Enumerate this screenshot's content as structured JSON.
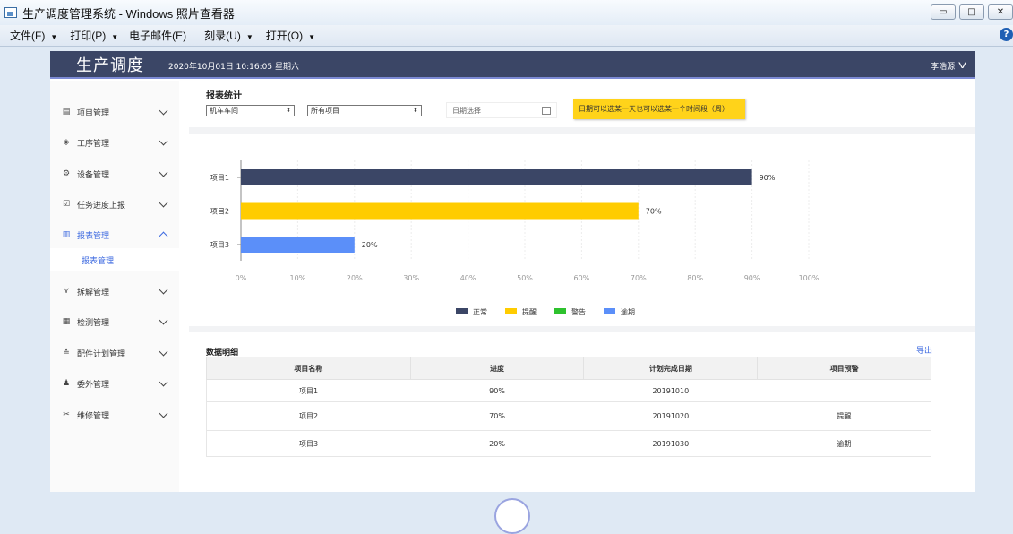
{
  "window": {
    "title": "生产调度管理系统 - Windows 照片查看器",
    "min": "▭",
    "max": "□",
    "close": "✕"
  },
  "menu": [
    {
      "label": "文件(F)",
      "caret": "▼"
    },
    {
      "label": "打印(P)",
      "caret": "▼"
    },
    {
      "label": "电子邮件(E)",
      "caret": ""
    },
    {
      "label": "刻录(U)",
      "caret": "▼"
    },
    {
      "label": "打开(O)",
      "caret": "▼"
    }
  ],
  "help": "?",
  "header": {
    "logo": "生产调度",
    "datetime": "2020年10月01日  10:16:05  星期六",
    "user": "李浩源",
    "user_chevron": "V"
  },
  "sidebar": {
    "items": [
      {
        "label": "项目管理",
        "icon": "list-icon",
        "glyph": "▤"
      },
      {
        "label": "工序管理",
        "icon": "layers-icon",
        "glyph": "◈"
      },
      {
        "label": "设备管理",
        "icon": "gear-icon",
        "glyph": "⚙"
      },
      {
        "label": "任务进度上报",
        "icon": "clipboard-icon",
        "glyph": "☑"
      },
      {
        "label": "报表管理",
        "icon": "bar-chart-icon",
        "glyph": "▥"
      },
      {
        "label": "拆解管理",
        "icon": "disassemble-icon",
        "glyph": "⋎"
      },
      {
        "label": "检测管理",
        "icon": "inspection-icon",
        "glyph": "▦"
      },
      {
        "label": "配件计划管理",
        "icon": "parts-icon",
        "glyph": "≛"
      },
      {
        "label": "委外管理",
        "icon": "person-icon",
        "glyph": "♟"
      },
      {
        "label": "维修管理",
        "icon": "tools-icon",
        "glyph": "✂"
      }
    ],
    "sub": {
      "label": "报表管理"
    }
  },
  "filter": {
    "title": "报表统计",
    "select1": "机车车间",
    "select2": "所有项目",
    "select_arrow": "⬍",
    "date_placeholder": "日期选择",
    "tip": "日期可以选某一天也可以选某一个时间段（周）"
  },
  "chart_data": {
    "type": "bar",
    "orientation": "horizontal",
    "categories": [
      "项目1",
      "项目2",
      "项目3"
    ],
    "values": [
      90,
      70,
      20
    ],
    "value_labels": [
      "90%",
      "70%",
      "20%"
    ],
    "bar_colors": [
      "#3b4666",
      "#ffcc00",
      "#5b8ff9"
    ],
    "xlim": [
      0,
      100
    ],
    "xticks": [
      "0%",
      "10%",
      "20%",
      "30%",
      "40%",
      "50%",
      "60%",
      "70%",
      "80%",
      "90%",
      "100%"
    ],
    "grid": "vertical",
    "legend": [
      {
        "name": "正常",
        "color": "#3b4666"
      },
      {
        "name": "提醒",
        "color": "#ffcc00"
      },
      {
        "name": "警告",
        "color": "#2ec22e"
      },
      {
        "name": "逾期",
        "color": "#5b8ff9"
      }
    ],
    "legend_position": "bottom"
  },
  "table": {
    "title": "数据明细",
    "export": "导出",
    "headers": [
      "项目名称",
      "进度",
      "计划完成日期",
      "项目预警"
    ],
    "rows": [
      [
        "项目1",
        "90%",
        "20191010",
        ""
      ],
      [
        "项目2",
        "70%",
        "20191020",
        "提醒"
      ],
      [
        "项目3",
        "20%",
        "20191030",
        "逾期"
      ]
    ]
  }
}
